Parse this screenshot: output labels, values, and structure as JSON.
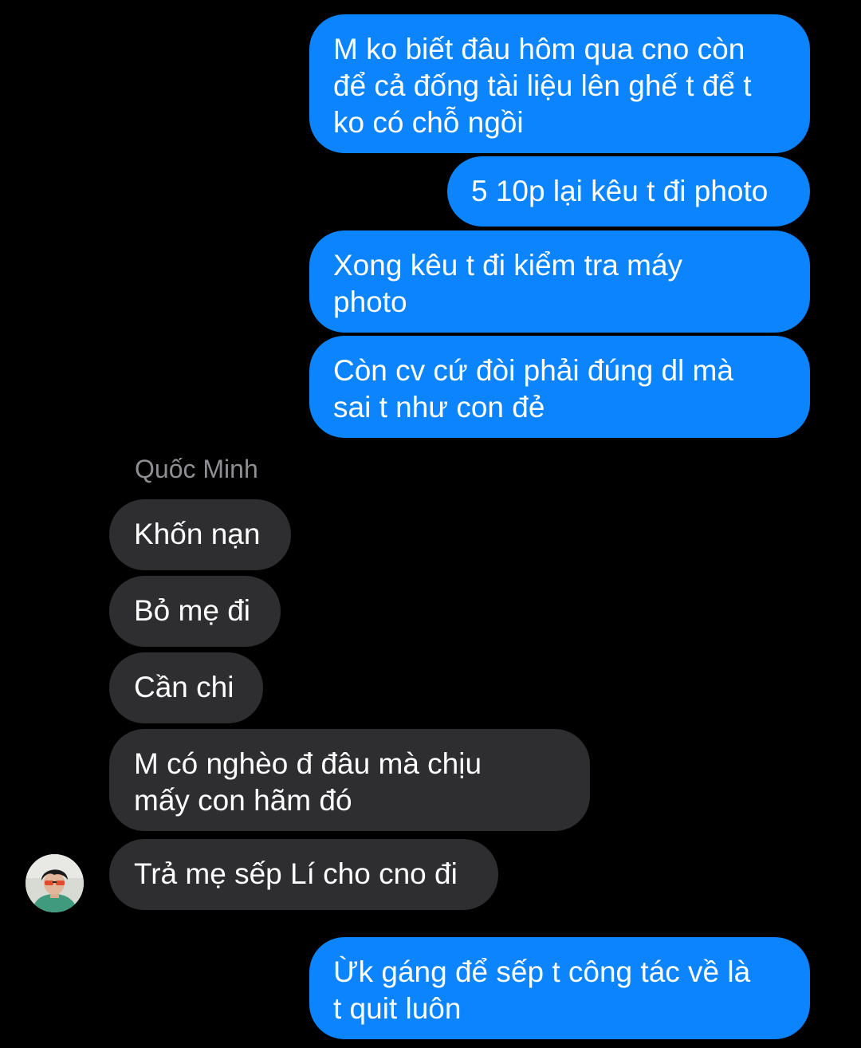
{
  "conversation": {
    "sender_name": "Quốc Minh",
    "messages_outgoing_top": [
      "M ko biết đâu hôm qua cno còn\nđể cả đống tài liệu lên ghế t để t\nko có chỗ ngồi",
      "5 10p lại kêu t đi photo",
      "Xong kêu t đi kiểm tra máy\nphoto",
      "Còn cv cứ đòi phải đúng dl mà\nsai t như con đẻ"
    ],
    "messages_incoming": [
      "Khốn nạn",
      "Bỏ mẹ đi",
      "Cần chi",
      "M có nghèo đ đâu mà chịu\nmấy con hãm đó",
      "Trả mẹ sếp Lí cho cno đi"
    ],
    "messages_outgoing_bottom": [
      "Ừk gáng để sếp t công tác về là\nt quit luôn"
    ],
    "avatar_icon": "user-avatar-photo",
    "colors": {
      "outgoing_bubble": "#0b84fe",
      "incoming_bubble": "#2e2e30",
      "background": "#000000",
      "sender_name": "#8e8e93"
    }
  }
}
